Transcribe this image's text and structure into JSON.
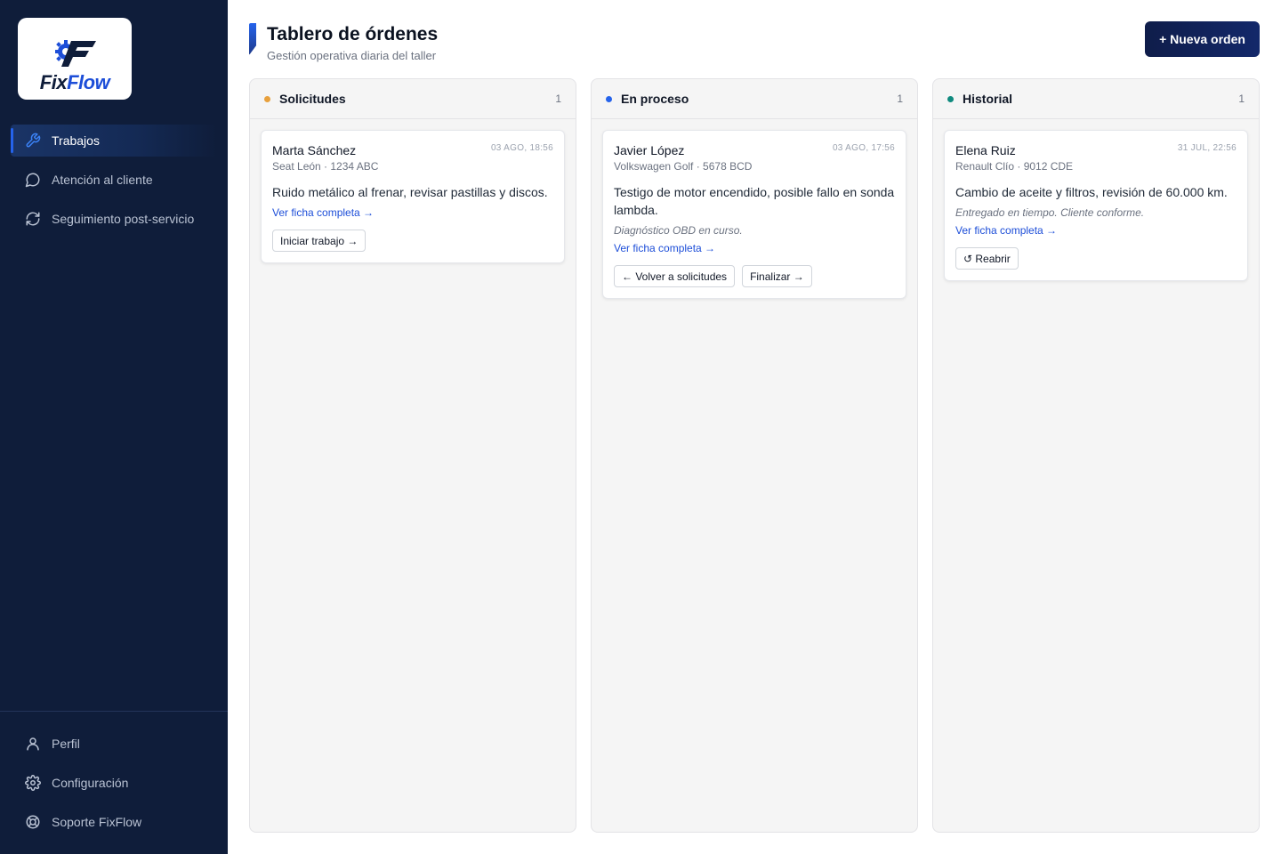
{
  "brand": {
    "part1": "Fix",
    "part2": "Flow",
    "accent": "#1d4ed8",
    "navy": "#0f1d3a"
  },
  "sidebar": {
    "items": [
      {
        "label": "Trabajos",
        "icon": "wrench-icon",
        "active": true
      },
      {
        "label": "Atención al cliente",
        "icon": "chat-bubble-icon",
        "active": false
      },
      {
        "label": "Seguimiento post-servicio",
        "icon": "refresh-icon",
        "active": false
      }
    ],
    "bottom_items": [
      {
        "label": "Perfil",
        "icon": "user-icon"
      },
      {
        "label": "Configuración",
        "icon": "gear-icon"
      },
      {
        "label": "Soporte FixFlow",
        "icon": "lifebuoy-icon"
      }
    ]
  },
  "header": {
    "title": "Tablero de órdenes",
    "subtitle": "Gestión operativa diaria del taller",
    "new_order_label": "+ Nueva orden"
  },
  "columns": [
    {
      "title": "Solicitudes",
      "count": "1",
      "dot_color": "#e8a03c",
      "cards": [
        {
          "name": "Marta Sánchez",
          "date": "03 AGO, 18:56",
          "vehicle": "Seat León · 1234 ABC",
          "description": "Ruido metálico al frenar, revisar pastillas y discos.",
          "link": "Ver ficha completa →",
          "actions": [
            "Iniciar trabajo →"
          ]
        }
      ]
    },
    {
      "title": "En proceso",
      "count": "1",
      "dot_color": "#2563eb",
      "cards": [
        {
          "name": "Javier López",
          "date": "03 AGO, 17:56",
          "vehicle": "Volkswagen Golf · 5678 BCD",
          "description": "Testigo de motor encendido, posible fallo en sonda lambda.",
          "note": "Diagnóstico OBD en curso.",
          "link": "Ver ficha completa →",
          "actions": [
            "← Volver a solicitudes",
            "Finalizar →"
          ]
        }
      ]
    },
    {
      "title": "Historial",
      "count": "1",
      "dot_color": "#0f8a7e",
      "cards": [
        {
          "name": "Elena Ruiz",
          "date": "31 JUL, 22:56",
          "vehicle": "Renault Clío · 9012 CDE",
          "description": "Cambio de aceite y filtros, revisión de 60.000 km.",
          "note": "Entregado en tiempo. Cliente conforme.",
          "link": "Ver ficha completa →",
          "actions": [
            "↺ Reabrir"
          ]
        }
      ]
    }
  ]
}
